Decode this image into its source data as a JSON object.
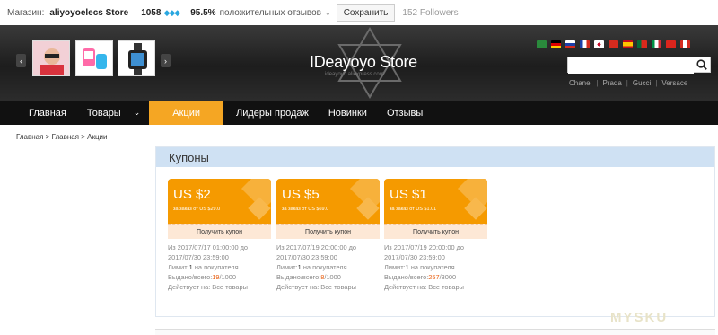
{
  "topbar": {
    "shop_label": "Магазин:",
    "store_name": "aliyoyoelecs Store",
    "score": "1058",
    "diamonds": "◆◆◆",
    "positive_pct": "95.5%",
    "feedback_label": "положительных отзывов",
    "save_label": "Сохранить",
    "followers": "152 Followers"
  },
  "banner": {
    "title": "IDeayoyo Store",
    "subtitle": "ideayoyo.aliexpress.com",
    "search_placeholder": "",
    "brands": [
      "Chanel",
      "Prada",
      "Gucci",
      "Versace"
    ],
    "flags": [
      "sa",
      "de",
      "ru",
      "fr",
      "kr",
      "tr",
      "es",
      "pt",
      "it",
      "vn",
      "ca"
    ]
  },
  "nav": {
    "items": [
      "Главная",
      "Товары",
      "Акции",
      "Лидеры продаж",
      "Новинки",
      "Отзывы"
    ]
  },
  "breadcrumb": "Главная > Главная > Акции",
  "coupons": {
    "heading": "Купоны",
    "button_label": "Получить купон",
    "cards": [
      {
        "amount": "US $2",
        "condition": "за заказ от US $29.0",
        "period": "Из 2017/07/17 01:00:00 до 2017/07/30 23:59:00",
        "limit_label": "Лимит:",
        "limit_value": "1",
        "limit_suffix": " на покупателя",
        "issued_label": "Выдано/всего:",
        "issued_value": "19",
        "issued_total": "/1000",
        "scope": "Действует на: Все товары"
      },
      {
        "amount": "US $5",
        "condition": "за заказ от US $69.0",
        "period": "Из 2017/07/19 20:00:00 до 2017/07/30 23:59:00",
        "limit_label": "Лимит:",
        "limit_value": "1",
        "limit_suffix": " на покупателя",
        "issued_label": "Выдано/всего:",
        "issued_value": "8",
        "issued_total": "/1000",
        "scope": "Действует на: Все товары"
      },
      {
        "amount": "US $1",
        "condition": "за заказ от US $1.01",
        "period": "Из 2017/07/19 20:00:00 до 2017/07/30 23:59:00",
        "limit_label": "Лимит:",
        "limit_value": "1",
        "limit_suffix": " на покупателя",
        "issued_label": "Выдано/всего:",
        "issued_value": "257",
        "issued_total": "/3000",
        "scope": "Действует на: Все товары"
      }
    ]
  },
  "watermark": "MYSKU",
  "colors": {
    "accent": "#f5a623",
    "coupon": "#f59a00",
    "highlight": "#e85c0d",
    "nav_bg": "#111111"
  }
}
